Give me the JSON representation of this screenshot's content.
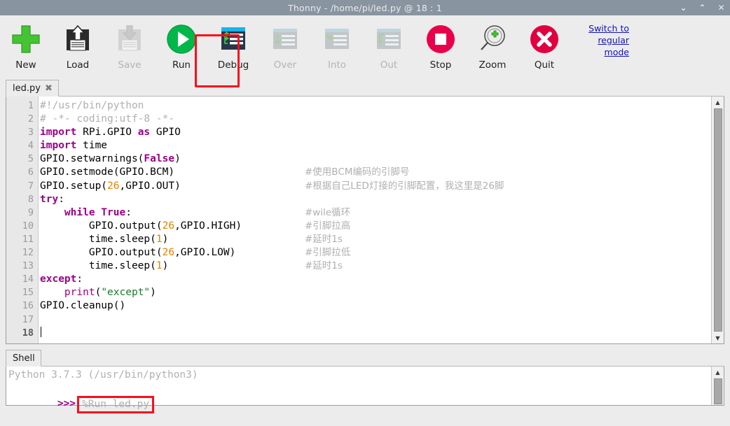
{
  "window": {
    "title": "Thonny  -  /home/pi/led.py @ 18 : 1",
    "controls": [
      {
        "name": "minimize",
        "glyph": "⌄"
      },
      {
        "name": "maximize",
        "glyph": "⌃"
      },
      {
        "name": "close",
        "glyph": "✕"
      }
    ]
  },
  "toolbar": {
    "buttons": [
      {
        "label": "New",
        "icon": "plus-icon",
        "enabled": true
      },
      {
        "label": "Load",
        "icon": "floppy-up-icon",
        "enabled": true
      },
      {
        "label": "Save",
        "icon": "floppy-down-icon",
        "enabled": false
      },
      {
        "label": "Run",
        "icon": "play-icon",
        "enabled": true
      },
      {
        "label": "Debug",
        "icon": "bug-window-icon",
        "enabled": true
      },
      {
        "label": "Over",
        "icon": "step-over-icon",
        "enabled": false
      },
      {
        "label": "Into",
        "icon": "step-into-icon",
        "enabled": false
      },
      {
        "label": "Out",
        "icon": "step-out-icon",
        "enabled": false
      },
      {
        "label": "Stop",
        "icon": "stop-icon",
        "enabled": true
      },
      {
        "label": "Zoom",
        "icon": "magnifier-plus-icon",
        "enabled": true
      },
      {
        "label": "Quit",
        "icon": "x-circle-icon",
        "enabled": true
      }
    ],
    "switch_mode_link": "Switch to regular mode",
    "highlight_color": "#fc0d1b"
  },
  "editor": {
    "tab": {
      "label": "led.py",
      "close_glyph": "✖"
    },
    "line_numbers": [
      "1",
      "2",
      "3",
      "4",
      "5",
      "6",
      "7",
      "8",
      "9",
      "10",
      "11",
      "12",
      "13",
      "14",
      "15",
      "16",
      "17",
      "18"
    ],
    "current_line": 18,
    "code_lines": [
      "#!/usr/bin/python",
      "# -*- coding:utf-8 -*-",
      "import RPi.GPIO as GPIO",
      "import time",
      "GPIO.setwarnings(False)",
      "GPIO.setmode(GPIO.BCM)",
      "GPIO.setup(26,GPIO.OUT)",
      "try:",
      "    while True:",
      "        GPIO.output(26,GPIO.HIGH)",
      "        time.sleep(1)",
      "        GPIO.output(26,GPIO.LOW)",
      "        time.sleep(1)",
      "except:",
      "    print(\"except\")",
      "GPIO.cleanup()",
      "",
      ""
    ],
    "side_comments": {
      "6": "#使用BCM编码的引脚号",
      "7": "#根据自己LED灯接的引脚配置，我这里是26脚",
      "9": "#wile循环",
      "10": "#引脚拉高",
      "11": "#延时1s",
      "12": "#引脚拉低",
      "13": "#延时1s"
    },
    "colors": {
      "comment": "#b0b0b0",
      "keyword": "#9a0089",
      "number": "#e08400",
      "string": "#1a7a2e",
      "text": "#000000"
    }
  },
  "shell": {
    "tab_label": "Shell",
    "banner": "Python 3.7.3 (/usr/bin/python3)",
    "prompt": ">>>",
    "command": "%Run led.py",
    "command_highlighted": true
  }
}
